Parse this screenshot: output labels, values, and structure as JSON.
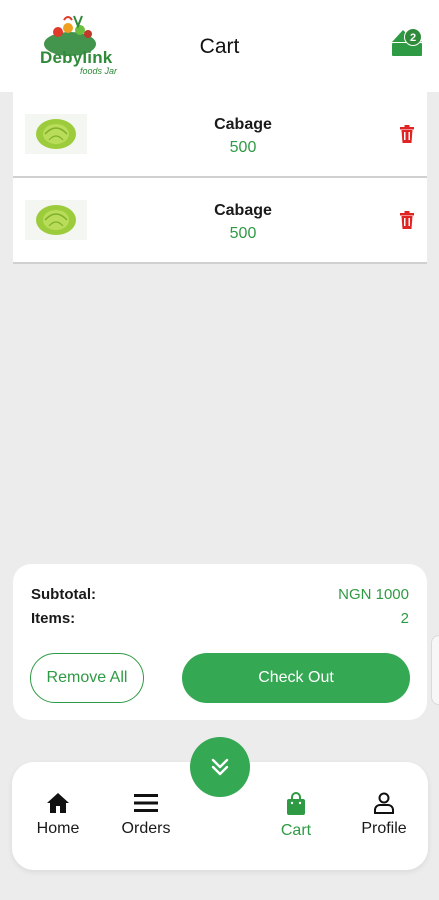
{
  "header": {
    "title": "Cart",
    "logo_text": "Debylink",
    "logo_subtext": "foods Jar",
    "cart_count": "2"
  },
  "cart_items": [
    {
      "name": "Cabage",
      "price": "500"
    },
    {
      "name": "Cabage",
      "price": "500"
    }
  ],
  "summary": {
    "subtotal_label": "Subtotal:",
    "subtotal_value": "NGN 1000",
    "items_label": "Items:",
    "items_value": "2",
    "remove_all_label": "Remove All",
    "checkout_label": "Check Out"
  },
  "nav": {
    "items": [
      {
        "label": "Home",
        "icon": "home-icon"
      },
      {
        "label": "Orders",
        "icon": "menu-icon"
      },
      {
        "label": "Cart",
        "icon": "shopping-bag-icon",
        "active": true
      },
      {
        "label": "Profile",
        "icon": "person-icon"
      }
    ],
    "fab_icon": "double-chevron-down-icon"
  },
  "colors": {
    "accent": "#34a853",
    "accent_text": "#2f9a44",
    "danger": "#e02424",
    "background": "#ececec"
  }
}
